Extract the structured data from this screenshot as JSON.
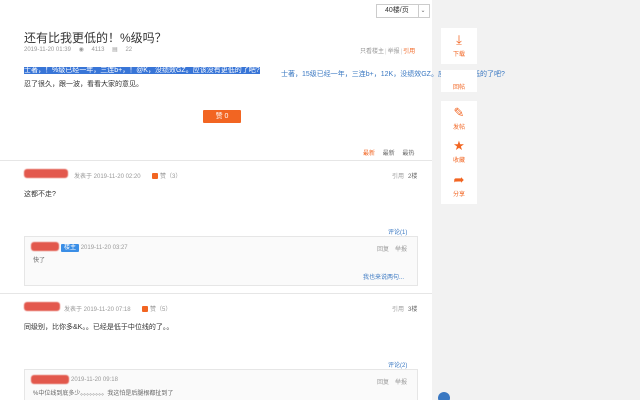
{
  "pager": {
    "label": "40楼/页"
  },
  "post": {
    "title": "还有比我更低的！%级吗？",
    "date": "2019-11-20 01:39",
    "views": "4113",
    "comments": "22",
    "actions": {
      "only_op": "只看楼主",
      "report": "举报",
      "quote": "引用"
    },
    "selected_text": "士著，！%级已经一年，三连b+，！@K，没绩效GZ。应该没有更低的了吧?",
    "overflow_text": "士著，15级已经一年，三连b+，12K，没绩效GZ。应该没有更低的了吧?",
    "line2": "忍了很久，跟一波，看看大家的意见。",
    "like_label": "赞 0"
  },
  "sort_tabs": {
    "new": "最新",
    "latest": "最新",
    "hot": "最热"
  },
  "replies": [
    {
      "date": "发表于 2019-11-20 02:20",
      "likes": "赞（3）",
      "quote": "引用",
      "floor": "2楼",
      "text": "这都不走?",
      "comment_link": "评论(1)",
      "sub": {
        "tag": "楼主",
        "date": "2019-11-20 03:27",
        "text": "快了",
        "reply": "回复",
        "report": "举报",
        "more": "我也来说两句..."
      }
    },
    {
      "date": "发表于 2019-11-20 07:18",
      "likes": "赞（5）",
      "quote": "引用",
      "floor": "3楼",
      "text": "同级别，比你多&K。。已经是低于中位线的了。。",
      "comment_link": "评论(2)",
      "sub": {
        "date": "2019-11-20 09:18",
        "text": "%中位线到底多少。。。。。。。。我这怕是后腿根都扯到了",
        "reply": "回复",
        "report": "举报"
      }
    }
  ],
  "toolbar": {
    "reply_label": "回帖",
    "items": [
      {
        "label": "下载",
        "icon": "download-icon"
      },
      {
        "label": "发帖",
        "icon": "edit-icon"
      },
      {
        "label": "收藏",
        "icon": "star-icon"
      },
      {
        "label": "分享",
        "icon": "share-icon"
      }
    ]
  },
  "colors": {
    "accent": "#f26522",
    "link": "#3a78c2",
    "selection": "#3875d7"
  }
}
